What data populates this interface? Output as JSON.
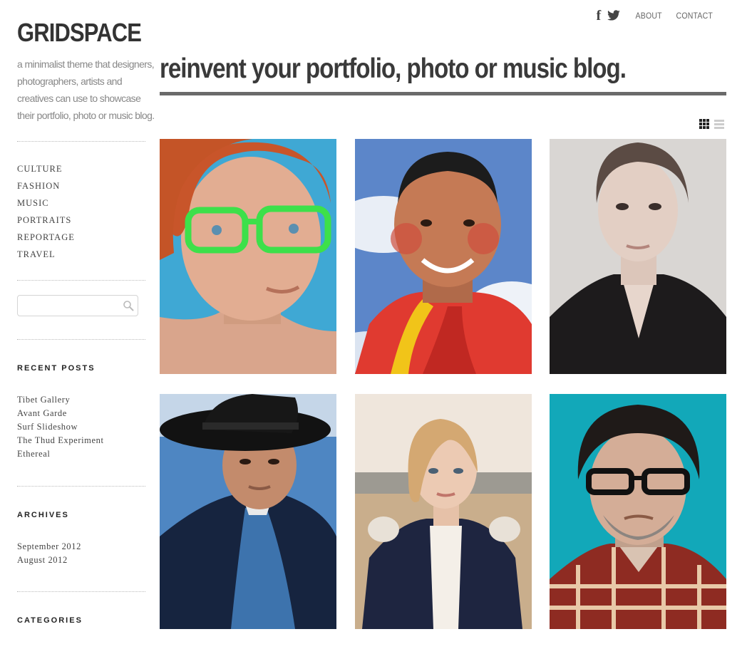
{
  "site": {
    "logo": "GRIDSPACE",
    "tagline": "a minimalist theme that designers, photographers, artists and creatives can use to showcase their portfolio, photo or music blog.",
    "headline": "reinvent your portfolio, photo or music blog."
  },
  "topnav": {
    "icons": [
      "facebook-icon",
      "twitter-icon"
    ],
    "links": [
      "ABOUT",
      "CONTACT"
    ]
  },
  "sidebar": {
    "categories_nav": [
      "CULTURE",
      "FASHION",
      "MUSIC",
      "PORTRAITS",
      "REPORTAGE",
      "TRAVEL"
    ],
    "search": {
      "placeholder": "",
      "icon": "search-icon"
    },
    "recent_posts": {
      "title": "RECENT POSTS",
      "items": [
        "Tibet Gallery",
        "Avant Garde",
        "Surf Slideshow",
        "The Thud Experiment",
        "Ethereal"
      ]
    },
    "archives": {
      "title": "ARCHIVES",
      "items": [
        "September 2012",
        "August 2012"
      ]
    },
    "categories_widget": {
      "title": "CATEGORIES"
    }
  },
  "view_toggle": {
    "grid_icon": "grid-view-icon",
    "list_icon": "list-view-icon",
    "active": "grid"
  },
  "colors": {
    "text": "#333333",
    "muted": "#888888",
    "rule": "#6a6a6a"
  }
}
